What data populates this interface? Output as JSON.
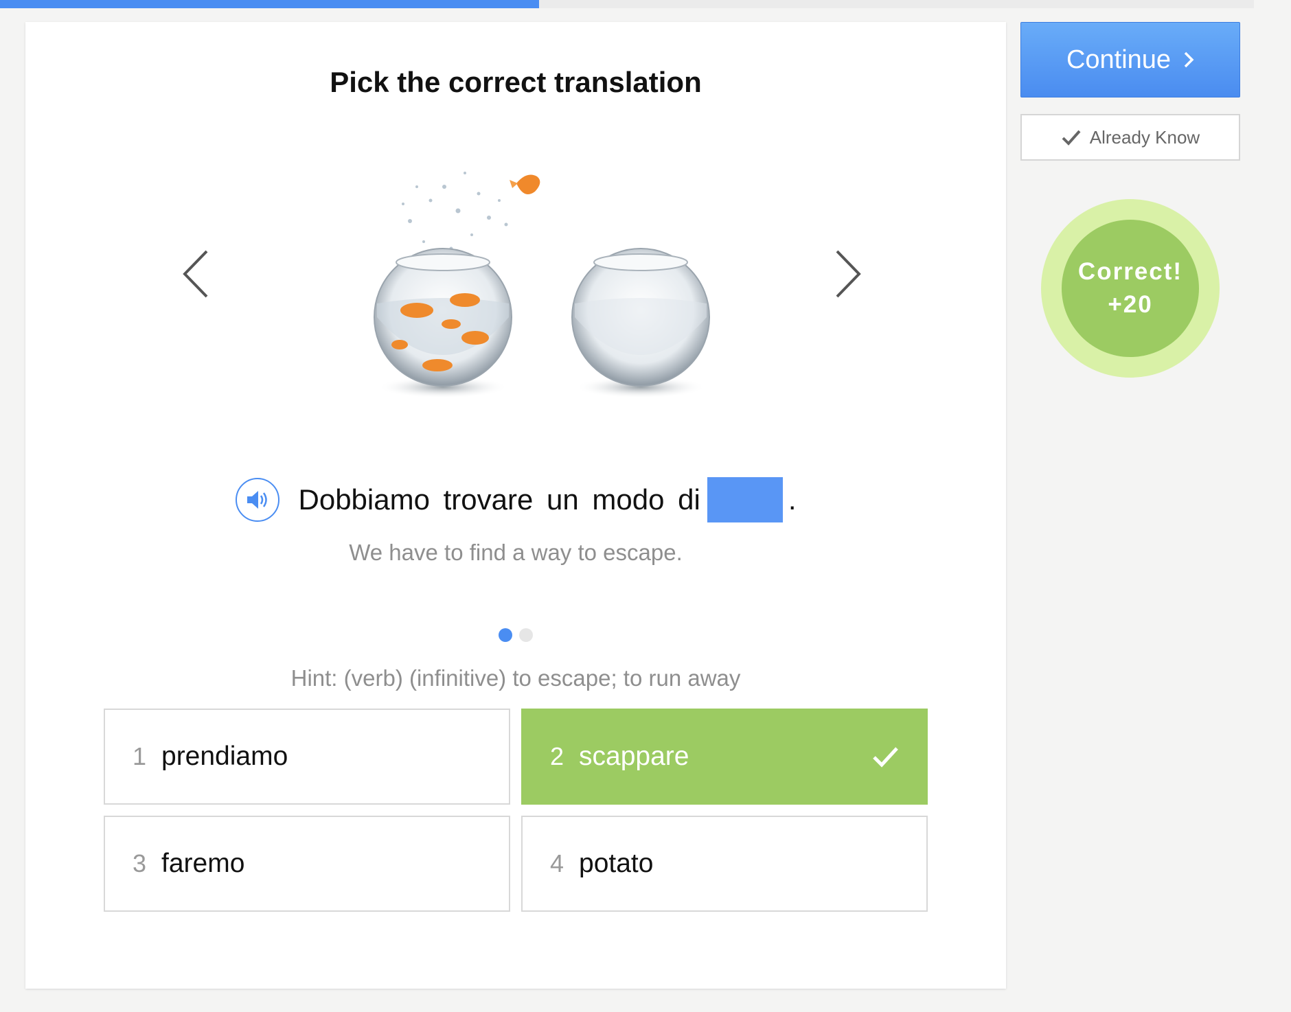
{
  "progress": {
    "percent": 43
  },
  "exercise": {
    "instruction": "Pick the correct translation",
    "sentence_text": "Dobbiamo trovare un modo di",
    "sentence_end": ".",
    "translation": "We have to find a way to escape.",
    "hint": "Hint: (verb) (infinitive) to escape; to run away",
    "slides": {
      "total": 2,
      "active": 1
    },
    "illustration": "goldfish-jumping-between-bowls"
  },
  "options": [
    {
      "number": "1",
      "word": "prendiamo",
      "state": "default"
    },
    {
      "number": "2",
      "word": "scappare",
      "state": "correct"
    },
    {
      "number": "3",
      "word": "faremo",
      "state": "default"
    },
    {
      "number": "4",
      "word": "potato",
      "state": "default"
    }
  ],
  "sidebar": {
    "continue_label": "Continue",
    "already_know_label": "Already Know",
    "feedback": {
      "line1": "Correct!",
      "line2": "+20"
    }
  },
  "colors": {
    "accent_blue": "#4a8df2",
    "correct_green": "#9ccb62",
    "correct_halo": "#d9f1a7"
  },
  "icons": [
    "chevron-left-icon",
    "chevron-right-icon",
    "speaker-icon",
    "check-icon",
    "chevron-right-small-icon"
  ]
}
